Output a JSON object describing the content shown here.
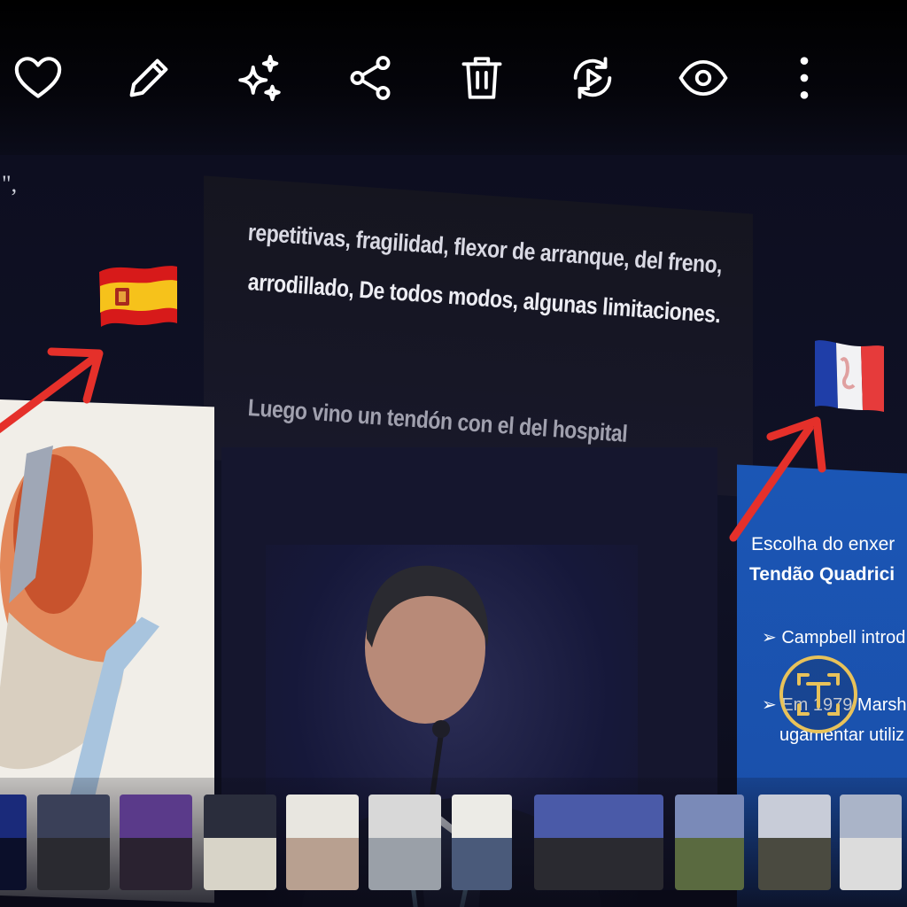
{
  "toolbar": {
    "icons": [
      "heart-icon",
      "pencil-icon",
      "sparkles-icon",
      "share-icon",
      "trash-icon",
      "replay-icon",
      "eye-icon",
      "more-vertical-icon"
    ]
  },
  "photo": {
    "stray_text": "\",",
    "caption_lines": [
      "repetitivas, fragilidad, flexor de arranque, del freno,",
      "arrodillado, De todos modos, algunas limitaciones.",
      "Luego vino un tendón con el del hospital"
    ],
    "flags": {
      "left": "spain-flag",
      "right": "france-flag"
    },
    "arrow_color": "#e5302a",
    "slide_text": [
      "Escolha do enxer",
      "Tendão Quadrici",
      "➢ Campbell introd",
      "➢ Em 1979 Marsh",
      "ugamentar utiliz"
    ],
    "slide_color": "#1b56b5"
  },
  "filmstrip": {
    "items": [
      {
        "name": "thumb-1",
        "top": "#1a2a7a",
        "bottom": "#0b0f2a"
      },
      {
        "name": "thumb-2",
        "top": "#3a4058",
        "bottom": "#2a2a30"
      },
      {
        "name": "thumb-3",
        "top": "#5a3a8a",
        "bottom": "#2a2230"
      },
      {
        "name": "thumb-4",
        "top": "#2a2d3c",
        "bottom": "#d8d4c8"
      },
      {
        "name": "thumb-5",
        "top": "#e8e6e0",
        "bottom": "#b8a090"
      },
      {
        "name": "thumb-6",
        "top": "#d8d8d8",
        "bottom": "#9aa0a8"
      },
      {
        "name": "thumb-7",
        "top": "#ecebe6",
        "bottom": "#4a5a7a"
      },
      {
        "name": "thumb-8",
        "top": "#4a5aa8",
        "bottom": "#2a2a30"
      },
      {
        "name": "thumb-9",
        "top": "#7a8ab8",
        "bottom": "#5a6a40"
      },
      {
        "name": "thumb-10",
        "top": "#c8ccd8",
        "bottom": "#4a4a40"
      },
      {
        "name": "thumb-11",
        "top": "#aab4c8",
        "bottom": "#dcdcdc"
      }
    ]
  }
}
